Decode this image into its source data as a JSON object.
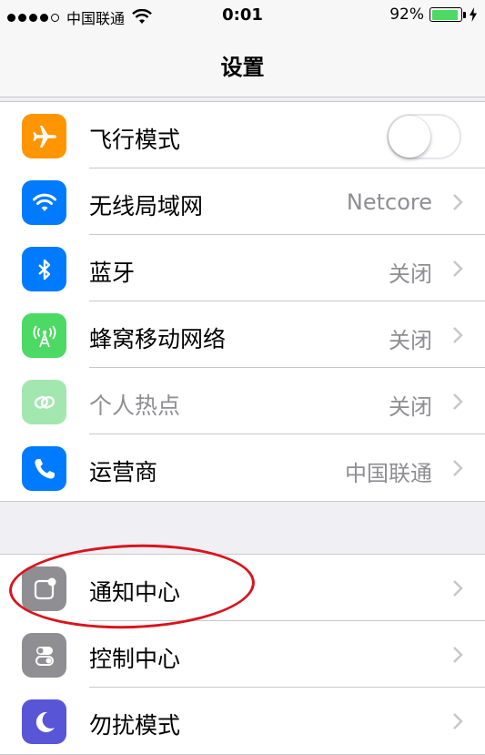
{
  "status_bar": {
    "carrier": "中国联通",
    "time": "0:01",
    "battery_percent": "92%",
    "battery_level": 0.92,
    "signal_bars_filled": 4,
    "signal_bars_total": 5
  },
  "nav": {
    "title": "设置"
  },
  "group1": {
    "items": [
      {
        "label": "飞行模式",
        "icon": "airplane-icon",
        "icon_color": "#ff9500",
        "toggle_on": false
      },
      {
        "label": "无线局域网",
        "icon": "wifi-icon",
        "icon_color": "#007aff",
        "detail": "Netcore"
      },
      {
        "label": "蓝牙",
        "icon": "bluetooth-icon",
        "icon_color": "#007aff",
        "detail": "关闭"
      },
      {
        "label": "蜂窝移动网络",
        "icon": "cellular-icon",
        "icon_color": "#4cd964",
        "detail": "关闭"
      },
      {
        "label": "个人热点",
        "icon": "hotspot-icon",
        "icon_color": "#a3e7b0",
        "detail": "关闭",
        "disabled": true
      },
      {
        "label": "运营商",
        "icon": "phone-icon",
        "icon_color": "#007aff",
        "detail": "中国联通"
      }
    ]
  },
  "group2": {
    "items": [
      {
        "label": "通知中心",
        "icon": "notification-center-icon",
        "icon_color": "#8e8e93"
      },
      {
        "label": "控制中心",
        "icon": "control-center-icon",
        "icon_color": "#8e8e93"
      },
      {
        "label": "勿扰模式",
        "icon": "moon-icon",
        "icon_color": "#5856d6"
      }
    ]
  },
  "colors": {
    "separator": "#c8c7cc",
    "background": "#efeff4",
    "annotation": "#d9141d"
  }
}
